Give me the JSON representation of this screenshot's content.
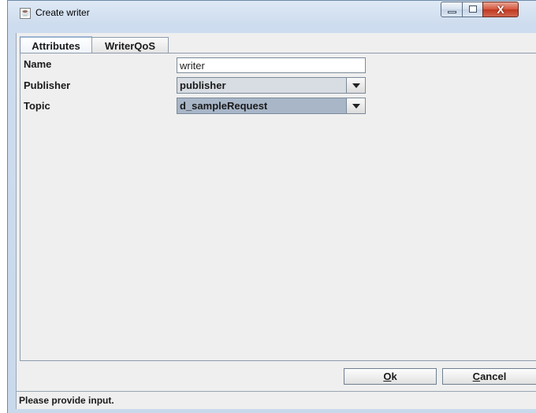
{
  "window": {
    "title": "Create writer",
    "icon": "java-cup-icon",
    "controls": {
      "minimize": "minimize-icon",
      "maximize": "maximize-icon",
      "close": "X"
    }
  },
  "tabs": [
    {
      "label": "Attributes",
      "active": true
    },
    {
      "label": "WriterQoS",
      "active": false
    }
  ],
  "form": {
    "name": {
      "label": "Name",
      "value": "writer"
    },
    "publisher": {
      "label": "Publisher",
      "value": "publisher"
    },
    "topic": {
      "label": "Topic",
      "value": "d_sampleRequest"
    }
  },
  "buttons": {
    "ok_mnemonic": "O",
    "ok_rest": "k",
    "cancel_mnemonic": "C",
    "cancel_rest": "ancel"
  },
  "status": {
    "text": "Please provide input."
  },
  "colors": {
    "selection": "#a8b6c8",
    "panel": "#efefef",
    "frame": "#cddcee"
  }
}
